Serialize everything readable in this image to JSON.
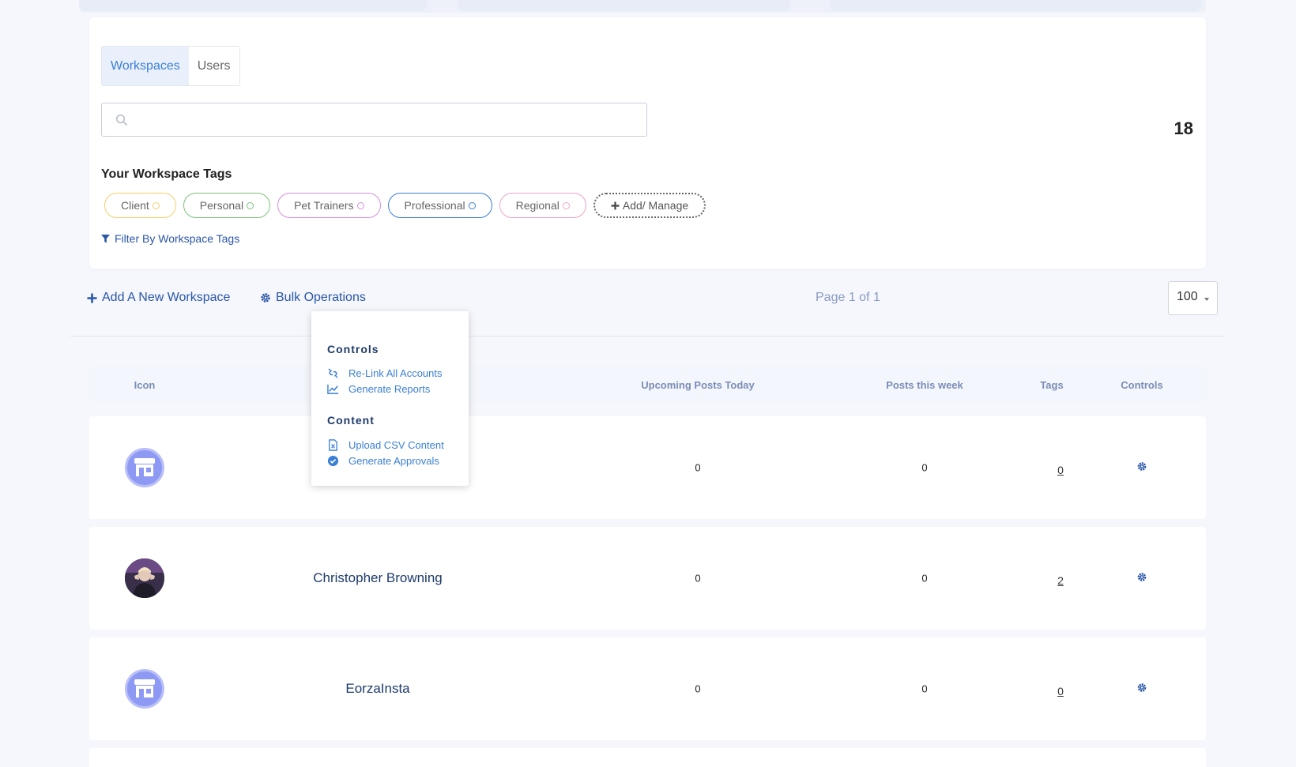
{
  "tabs": [
    {
      "label": "Workspaces",
      "active": true
    },
    {
      "label": "Users",
      "active": false
    }
  ],
  "search": {
    "placeholder": "",
    "icon": "search-icon"
  },
  "workspace_count": "18",
  "workspace_tags": {
    "title": "Your Workspace Tags",
    "tags": [
      {
        "label": "Client",
        "color": "#f2d06b"
      },
      {
        "label": "Personal",
        "color": "#7cc47c"
      },
      {
        "label": "Pet Trainers",
        "color": "#d88ee0"
      },
      {
        "label": "Professional",
        "color": "#3a7fd5"
      },
      {
        "label": "Regional",
        "color": "#f0a3c8"
      }
    ],
    "add_label": "Add/ Manage",
    "filter_label": "Filter By Workspace Tags"
  },
  "actions": {
    "add_workspace": "Add A New Workspace",
    "bulk_operations": "Bulk Operations"
  },
  "pagination": {
    "page_info": "Page 1 of 1",
    "per_page": "100"
  },
  "bulk_menu": {
    "controls_heading": "Controls",
    "controls_items": [
      "Re-Link All Accounts",
      "Generate Reports"
    ],
    "content_heading": "Content",
    "content_items": [
      "Upload CSV Content",
      "Generate Approvals"
    ]
  },
  "table": {
    "headers": {
      "icon": "Icon",
      "upcoming": "Upcoming Posts Today",
      "week": "Posts this week",
      "tags": "Tags",
      "controls": "Controls"
    },
    "rows": [
      {
        "name": "",
        "avatar": "store-icon",
        "upcoming": "0",
        "week": "0",
        "tags": "0"
      },
      {
        "name": "Christopher Browning",
        "avatar": "user-photo",
        "upcoming": "0",
        "week": "0",
        "tags": "2"
      },
      {
        "name": "EorzaInsta",
        "avatar": "store-icon",
        "upcoming": "0",
        "week": "0",
        "tags": "0"
      }
    ]
  },
  "colors": {
    "accent": "#3a7fd5",
    "link": "#2a56a8",
    "header_text": "#7b8db5"
  }
}
